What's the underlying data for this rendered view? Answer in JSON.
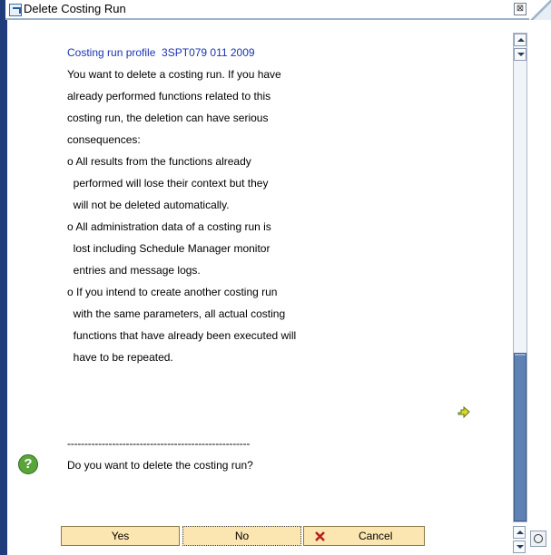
{
  "window": {
    "title": "Delete Costing Run",
    "close_icon": "close-icon"
  },
  "message": {
    "profile_line": "Costing run profile  3SPT079 011 2009",
    "lines": [
      "You want to delete a costing run. If you have",
      "already performed functions related to this",
      "costing run, the deletion can have serious",
      "consequences:",
      "o All results from the functions already",
      "  performed will lose their context but they",
      "  will not be deleted automatically.",
      "o All administration data of a costing run is",
      "  lost including Schedule Manager monitor",
      "  entries and message logs.",
      "o If you intend to create another costing run",
      "  with the same parameters, all actual costing",
      "  functions that have already been executed will",
      "  have to be repeated."
    ],
    "separator": "-----------------------------------------------------",
    "question": "Do you want to delete the costing run?"
  },
  "buttons": {
    "yes": "Yes",
    "no": "No",
    "cancel": "Cancel"
  },
  "colors": {
    "accent": "#1f3d7a",
    "profile_text": "#1a33b3",
    "button_bg": "#fbe6b1",
    "question_icon": "#5aa53a",
    "scroll_thumb": "#5f82b4"
  }
}
